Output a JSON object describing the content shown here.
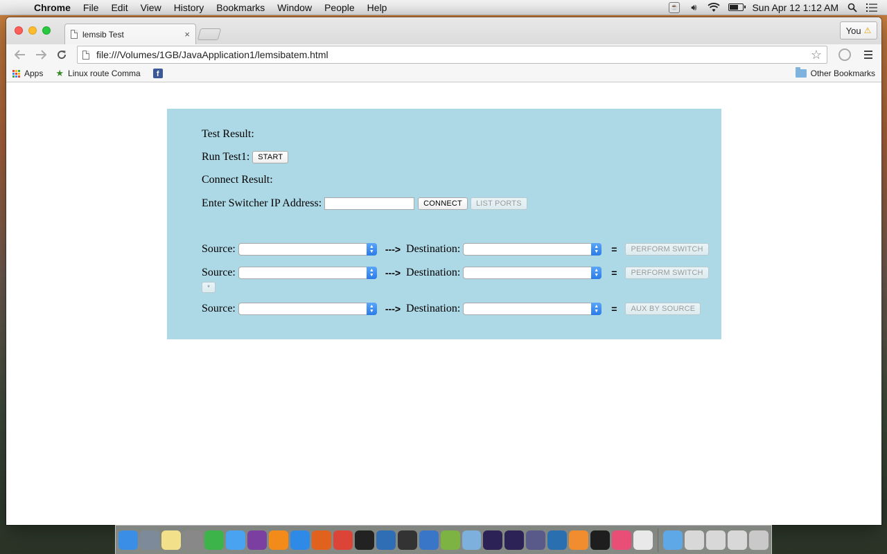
{
  "menubar": {
    "app_name": "Chrome",
    "items": [
      "File",
      "Edit",
      "View",
      "History",
      "Bookmarks",
      "Window",
      "People",
      "Help"
    ],
    "clock": "Sun Apr 12  1:12 AM"
  },
  "browser": {
    "tab_title": "lemsib Test",
    "tab_close": "×",
    "profile_label": "You",
    "profile_warning": "⚠",
    "url": "file:///Volumes/1GB/JavaApplication1/lemsibatem.html",
    "bookmarks": {
      "apps": "Apps",
      "linux": "Linux route Comma",
      "other": "Other Bookmarks"
    }
  },
  "page": {
    "test_result_label": "Test Result:",
    "run_test_label": "Run Test1:",
    "start_button": "START",
    "connect_result_label": "Connect Result:",
    "ip_label": "Enter Switcher IP Address:",
    "ip_value": "",
    "connect_button": "CONNECT",
    "list_ports_button": "LIST PORTS",
    "source_label": "Source:",
    "arrow": "--->",
    "destination_label": "Destination:",
    "equals": "=",
    "perform_switch_button": "PERFORM SWITCH",
    "aux_by_source_button": "AUX BY SOURCE",
    "small_button": "*"
  },
  "dock": {
    "apps": [
      {
        "name": "finder",
        "color": "#3a8ee6"
      },
      {
        "name": "launchpad",
        "color": "#7d8a99"
      },
      {
        "name": "notes",
        "color": "#f3e08a"
      },
      {
        "name": "calculator",
        "color": "#888888"
      },
      {
        "name": "facetime",
        "color": "#3cb44a"
      },
      {
        "name": "messages",
        "color": "#4aa3f0"
      },
      {
        "name": "eclipse-purple",
        "color": "#7a3fa0"
      },
      {
        "name": "vlc",
        "color": "#f28b1a"
      },
      {
        "name": "safari",
        "color": "#2e8ae6"
      },
      {
        "name": "firefox",
        "color": "#e0621c"
      },
      {
        "name": "chrome",
        "color": "#db4437"
      },
      {
        "name": "terminal",
        "color": "#222222"
      },
      {
        "name": "virtualbox",
        "color": "#2f6db5"
      },
      {
        "name": "unity",
        "color": "#333333"
      },
      {
        "name": "xcode",
        "color": "#3a76c8"
      },
      {
        "name": "android-studio",
        "color": "#7cb342"
      },
      {
        "name": "cube-app",
        "color": "#7db0dd"
      },
      {
        "name": "eclipse-1",
        "color": "#2c2255"
      },
      {
        "name": "eclipse-2",
        "color": "#2c2255"
      },
      {
        "name": "bbedit",
        "color": "#5a5a8a"
      },
      {
        "name": "netbeans",
        "color": "#2a6fb0"
      },
      {
        "name": "sublime",
        "color": "#f18d2e"
      },
      {
        "name": "activity-monitor",
        "color": "#1e1e1e"
      },
      {
        "name": "photos",
        "color": "#e94e77"
      },
      {
        "name": "java",
        "color": "#e9e9e9"
      },
      {
        "name": "downloads-folder",
        "color": "#5fa8e8"
      },
      {
        "name": "window-1",
        "color": "#d8d8d8"
      },
      {
        "name": "window-2",
        "color": "#d8d8d8"
      },
      {
        "name": "window-3",
        "color": "#d8d8d8"
      },
      {
        "name": "trash",
        "color": "#c9c9c9"
      }
    ]
  }
}
